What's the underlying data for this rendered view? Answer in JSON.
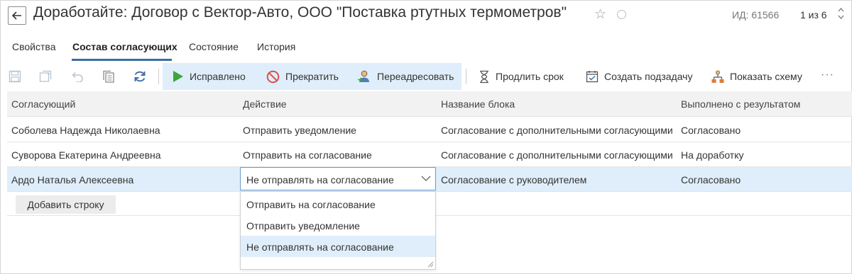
{
  "header": {
    "back_label": "←",
    "title": "Доработайте: Договор с Вектор-Авто, ООО \"Поставка ртутных термометров\"",
    "star_glyph": "☆",
    "doc_id": "ИД: 61566",
    "pager": "1 из 6"
  },
  "tabs": [
    {
      "label": "Свойства"
    },
    {
      "label": "Состав согласующих"
    },
    {
      "label": "Состояние"
    },
    {
      "label": "История"
    }
  ],
  "toolbar": {
    "icons": [
      "save-icon",
      "save-copy-icon",
      "undo-icon",
      "copy-icon",
      "refresh-icon"
    ],
    "actions": {
      "fixed": "Исправлено",
      "stop": "Прекратить",
      "redirect": "Переадресовать",
      "extend": "Продлить срок",
      "subtask": "Создать подзадачу",
      "scheme": "Показать схему"
    },
    "more_label": "···"
  },
  "table": {
    "columns": [
      "Согласующий",
      "Действие",
      "Название блока",
      "Выполнено с результатом"
    ],
    "rows": [
      [
        "Соболева Надежда Николаевна",
        "Отправить уведомление",
        "Согласование с дополнительными согласующими",
        "Согласовано"
      ],
      [
        "Суворова Екатерина Андреевна",
        "Отправить на согласование",
        "Согласование с дополнительными согласующими",
        "На доработку"
      ],
      [
        "Ардо Наталья Алексеевна",
        "Не отправлять на согласование",
        "Согласование с руководителем",
        "Согласовано"
      ]
    ],
    "add_row_label": "Добавить строку"
  },
  "dropdown": {
    "selected": "Не отправлять на согласование",
    "options": [
      "Отправить на согласование",
      "Отправить уведомление",
      "Не отправлять на согласование"
    ]
  },
  "colors": {
    "accent": "#3b6ea5",
    "selection": "#dfeefa",
    "play_green": "#3aa63a",
    "stop_red": "#d9534f"
  }
}
